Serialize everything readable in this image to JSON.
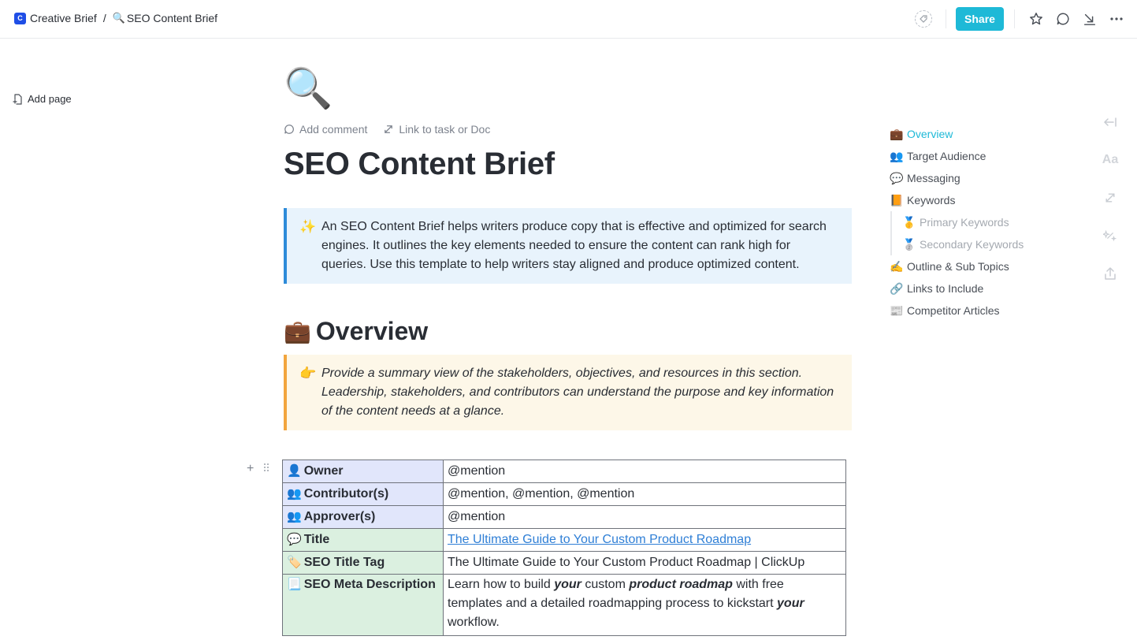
{
  "breadcrumb": {
    "space_initial": "C",
    "space_name": "Creative Brief",
    "separator": "/",
    "page_emoji": "🔍",
    "page_name": "SEO Content Brief"
  },
  "topbar": {
    "share_label": "Share",
    "icons": [
      "tag-icon",
      "star-icon",
      "comment-icon",
      "collapse-icon",
      "more-icon"
    ]
  },
  "sidebar": {
    "add_page_label": "Add page"
  },
  "doc": {
    "icon": "🔍",
    "add_comment_label": "Add comment",
    "link_label": "Link to task or Doc",
    "title": "SEO Content Brief",
    "intro_callout": {
      "emoji": "✨",
      "text": "An SEO Content Brief helps writers produce copy that is effective and optimized for search engines. It outlines the key elements needed to ensure the content can rank high for queries. Use this template to help writers stay aligned and produce optimized content."
    },
    "overview_heading": {
      "emoji": "💼",
      "text": "Overview"
    },
    "overview_callout": {
      "emoji": "👉",
      "text": "Provide a summary view of the stakeholders, objectives, and resources in this section. Leadership, stakeholders, and contributors can understand the purpose and key information of the content needs at a glance."
    },
    "table": {
      "rows": [
        {
          "emoji": "👤",
          "key": "Owner",
          "value": "@mention"
        },
        {
          "emoji": "👥",
          "key": "Contributor(s)",
          "value": "@mention, @mention, @mention"
        },
        {
          "emoji": "👥",
          "key": "Approver(s)",
          "value": "@mention"
        },
        {
          "emoji": "💬",
          "key": "Title",
          "value": "The Ultimate Guide to Your Custom Product Roadmap"
        },
        {
          "emoji": "🏷️",
          "key": "SEO Title Tag",
          "value": "The Ultimate Guide to Your Custom Product Roadmap | ClickUp"
        },
        {
          "emoji": "📃",
          "key": "SEO Meta Description",
          "value_parts": [
            "Learn how to build ",
            "your",
            " custom ",
            "product roadmap",
            " with free templates and a detailed roadmapping process to kickstart ",
            "your",
            " workflow."
          ]
        }
      ]
    }
  },
  "toc": {
    "items": [
      {
        "emoji": "💼",
        "label": "Overview",
        "active": true
      },
      {
        "emoji": "👥",
        "label": "Target Audience"
      },
      {
        "emoji": "💬",
        "label": "Messaging"
      },
      {
        "emoji": "📙",
        "label": "Keywords"
      },
      {
        "emoji": "🥇",
        "label": "Primary Keywords",
        "level": 2
      },
      {
        "emoji": "🥈",
        "label": "Secondary Keywords",
        "level": 2
      },
      {
        "emoji": "✍️",
        "label": "Outline & Sub Topics"
      },
      {
        "emoji": "🔗",
        "label": "Links to Include"
      },
      {
        "emoji": "📰",
        "label": "Competitor Articles"
      }
    ]
  },
  "right_rail": {
    "font_label": "Aa",
    "icons": [
      "collapse-left-icon",
      "font-icon",
      "link-icon",
      "magic-wand-icon",
      "export-icon"
    ]
  },
  "colors": {
    "accent": "#1eb9d7",
    "space_badge": "#1f4ee6",
    "info_callout_bg": "#e8f3fc",
    "info_callout_border": "#2d8bd9",
    "warn_callout_bg": "#fdf7e8",
    "warn_callout_border": "#f2a53d",
    "table_people_bg": "#e1e6fb",
    "table_content_bg": "#dbf0e0",
    "link": "#2f7fd6"
  }
}
